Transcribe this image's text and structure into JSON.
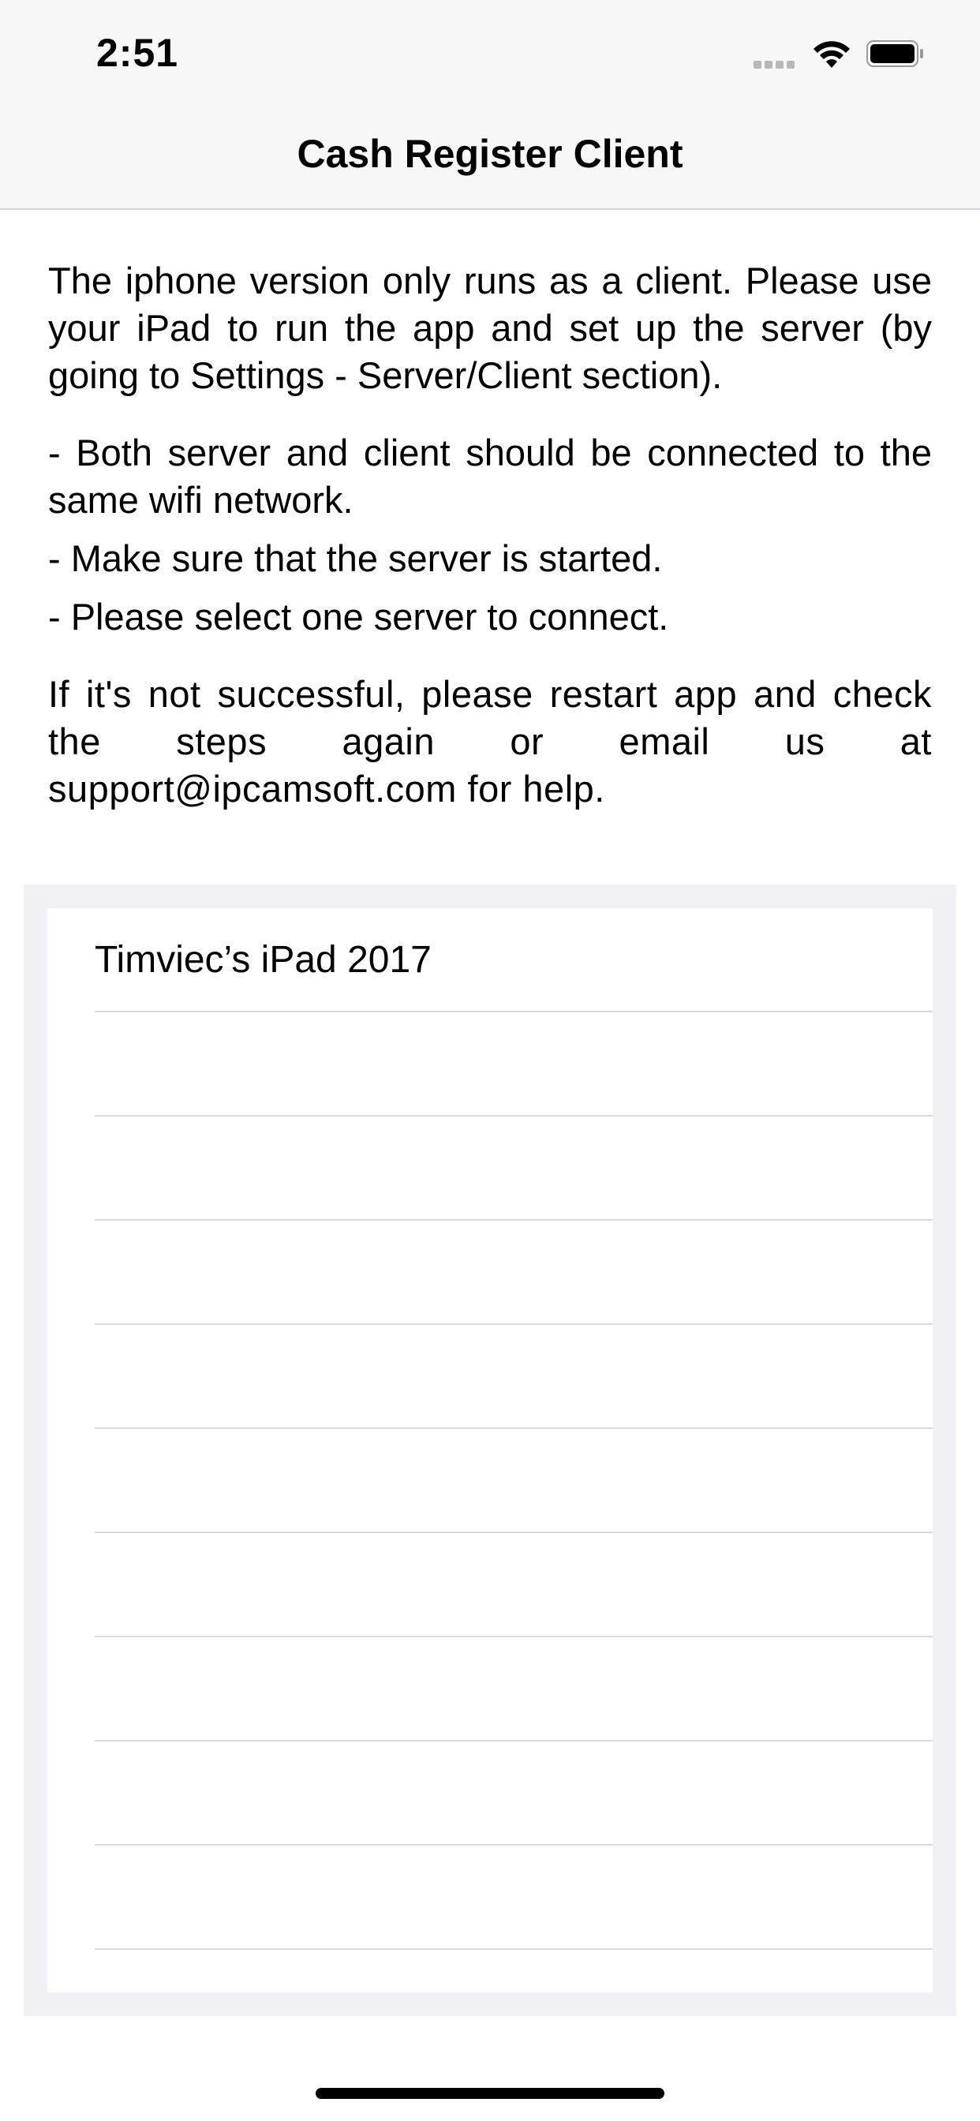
{
  "status_bar": {
    "time": "2:51"
  },
  "nav": {
    "title": "Cash Register Client"
  },
  "info": {
    "intro": "The iphone version only runs as a client. Please use your iPad to run the app and set up the server (by going to Settings - Server/Client section).",
    "bullets": [
      "- Both server and client should be connected to the same wifi network.",
      "- Make sure that the server is started.",
      "- Please select one server to connect."
    ],
    "help": "If it's not successful, please restart app and check the steps again or email us at support@ipcamsoft.com for help."
  },
  "servers": [
    {
      "name": "Timviec’s iPad 2017"
    },
    {
      "name": ""
    },
    {
      "name": ""
    },
    {
      "name": ""
    },
    {
      "name": ""
    },
    {
      "name": ""
    },
    {
      "name": ""
    },
    {
      "name": ""
    },
    {
      "name": ""
    },
    {
      "name": ""
    }
  ],
  "icons": {
    "signal": "cellular-signal-icon",
    "wifi": "wifi-icon",
    "battery": "battery-icon"
  }
}
